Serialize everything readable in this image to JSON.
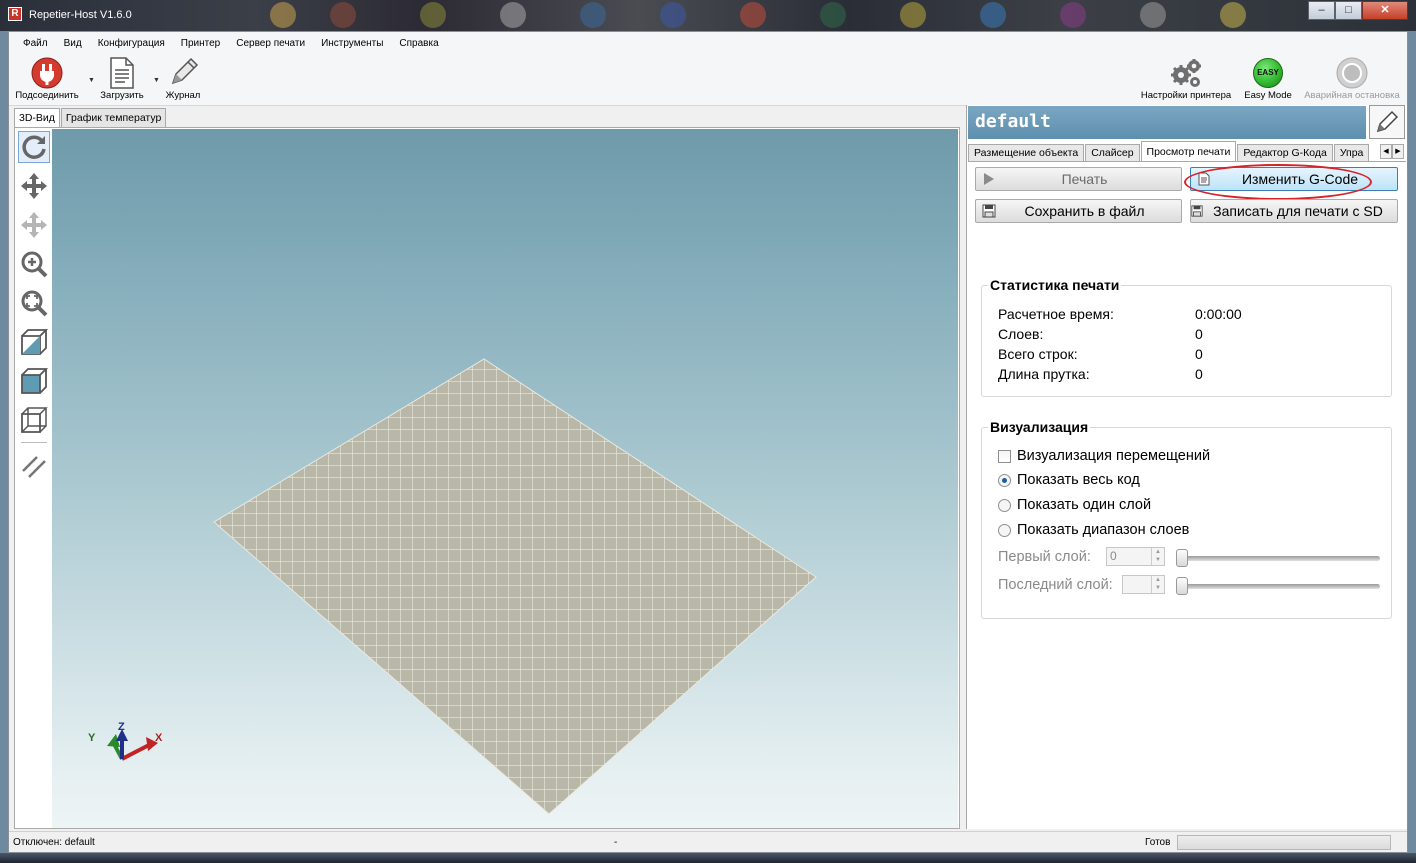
{
  "window": {
    "title": "Repetier-Host V1.6.0",
    "controls": {
      "minimize": "–",
      "maximize": "□",
      "close": "✕"
    }
  },
  "menu": [
    "Файл",
    "Вид",
    "Конфигурация",
    "Принтер",
    "Сервер печати",
    "Инструменты",
    "Справка"
  ],
  "toolbar": {
    "connect": "Подсоединить",
    "load": "Загрузить",
    "log": "Журнал",
    "printer_settings": "Настройки принтера",
    "easy_mode": "Easy Mode",
    "easy_badge": "EASY",
    "emergency_stop": "Аварийная остановка"
  },
  "left_tabs": [
    "3D-Вид",
    "График температур"
  ],
  "axes": {
    "x": "X",
    "y": "Y",
    "z": "Z"
  },
  "right": {
    "printer_name": "default",
    "tabs": [
      "Размещение объекта",
      "Слайсер",
      "Просмотр печати",
      "Редактор G-Кода",
      "Упра"
    ],
    "active_tab": "Просмотр печати",
    "buttons": {
      "print": "Печать",
      "edit_gcode": "Изменить G-Code",
      "save_file": "Сохранить в файл",
      "write_sd": "Записать для печати с SD"
    },
    "stats": {
      "title": "Статистика печати",
      "rows": [
        {
          "label": "Расчетное время:",
          "value": "0:00:00"
        },
        {
          "label": "Слоев:",
          "value": "0"
        },
        {
          "label": "Всего строк:",
          "value": "0"
        },
        {
          "label": "Длина прутка:",
          "value": "0"
        }
      ]
    },
    "visualization": {
      "title": "Визуализация",
      "show_moves": "Визуализация перемещений",
      "show_moves_checked": false,
      "show_all": "Показать весь код",
      "show_one": "Показать один слой",
      "show_range": "Показать диапазон слоев",
      "selected": "show_all",
      "first_layer_label": "Первый слой:",
      "first_layer_value": "0",
      "last_layer_label": "Последний слой:",
      "last_layer_value": ""
    }
  },
  "status": {
    "connection": "Отключен: default",
    "middle": "-",
    "ready": "Готов"
  },
  "colors": {
    "accent": "#5e8fae",
    "bed": "#b9b8a8",
    "highlight": "#d8222a",
    "connect_red": "#d43a2e",
    "easy_green": "#2fb52b"
  }
}
